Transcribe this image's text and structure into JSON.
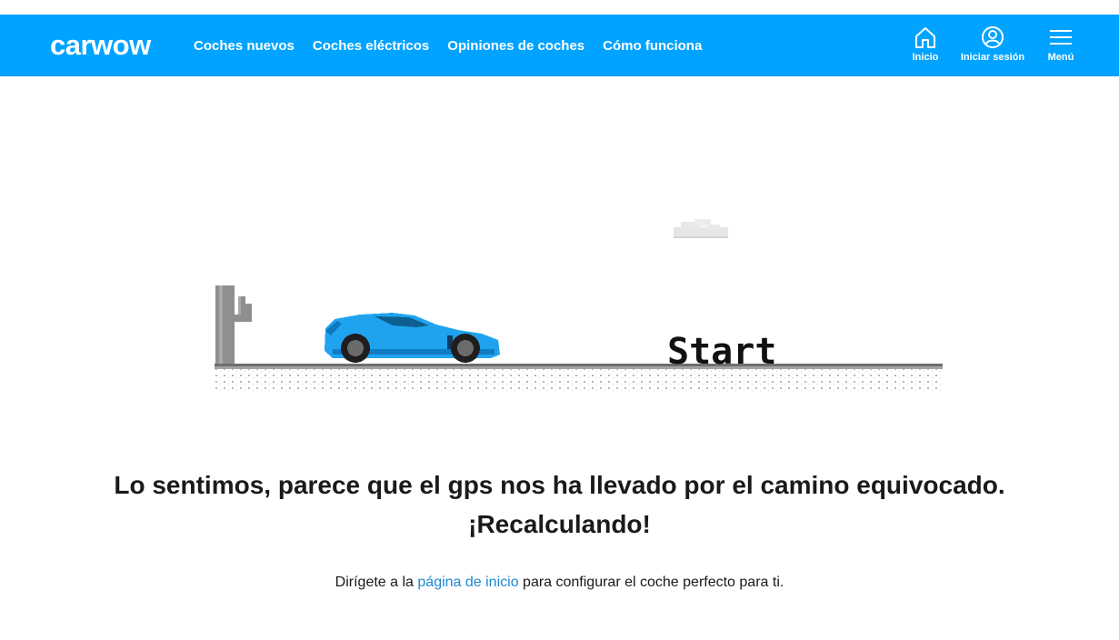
{
  "header": {
    "logo": "carwow",
    "nav": [
      "Coches nuevos",
      "Coches eléctricos",
      "Opiniones de coches",
      "Cómo funciona"
    ],
    "actions": {
      "home": "Inicio",
      "login": "Iniciar sesión",
      "menu": "Menú"
    }
  },
  "game": {
    "start_label": "Start"
  },
  "error": {
    "line1": "Lo sentimos, parece que el gps nos ha llevado por el camino equivocado.",
    "line2": "¡Recalculando!"
  },
  "help": {
    "prefix": "Dirígete a la ",
    "link": "página de inicio",
    "suffix": " para configurar el coche perfecto para ti."
  },
  "colors": {
    "brand": "#00a3ff",
    "link": "#1e88d2",
    "car": "#1fa3ef"
  }
}
